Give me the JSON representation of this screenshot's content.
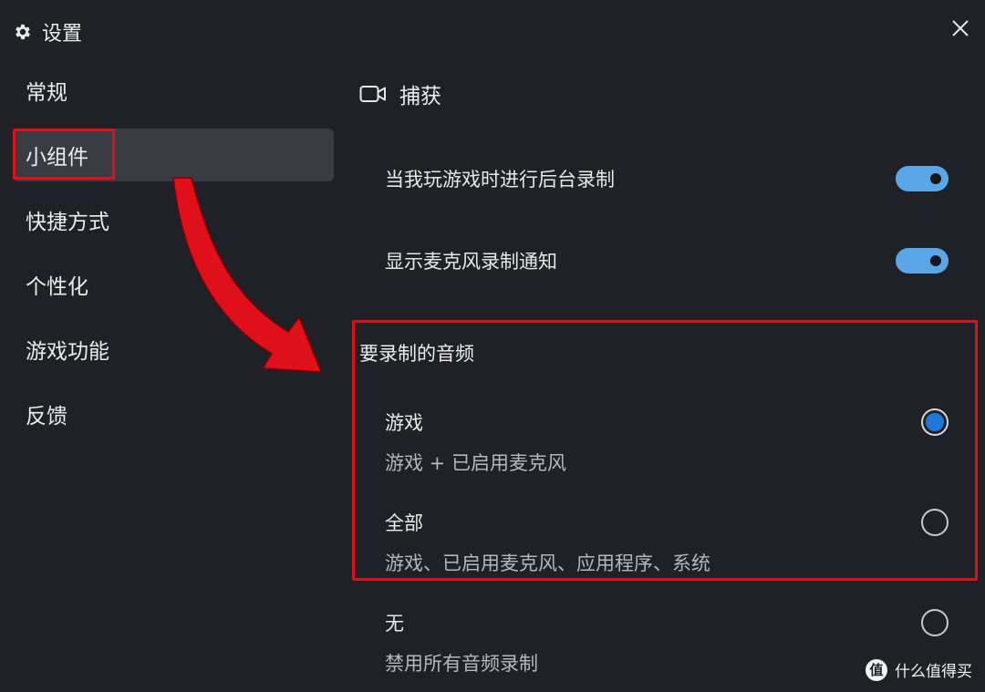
{
  "window": {
    "title": "设置",
    "icons": {
      "settings": "gear-icon",
      "close": "close-icon"
    }
  },
  "sidebar": {
    "items": [
      {
        "label": "常规"
      },
      {
        "label": "小组件"
      },
      {
        "label": "快捷方式"
      },
      {
        "label": "个性化"
      },
      {
        "label": "游戏功能"
      },
      {
        "label": "反馈"
      }
    ],
    "active_index": 1
  },
  "main": {
    "section": {
      "title": "捕获",
      "icon": "camera-icon"
    },
    "toggles": [
      {
        "label": "当我玩游戏时进行后台录制",
        "on": true
      },
      {
        "label": "显示麦克风录制通知",
        "on": true
      }
    ],
    "audio": {
      "title": "要录制的音频",
      "options": [
        {
          "label": "游戏",
          "desc": "游戏 + 已启用麦克风",
          "selected": true
        },
        {
          "label": "全部",
          "desc": "游戏、已启用麦克风、应用程序、系统",
          "selected": false
        },
        {
          "label": "无",
          "desc": "禁用所有音频录制",
          "selected": false
        }
      ]
    }
  },
  "annotation": {
    "color": "#e0101a"
  },
  "colors": {
    "accent": "#5aa6e6",
    "radio_selected": "#1e78d8",
    "background": "#202127"
  },
  "watermark": {
    "text": "什么值得买",
    "logo": "值"
  }
}
